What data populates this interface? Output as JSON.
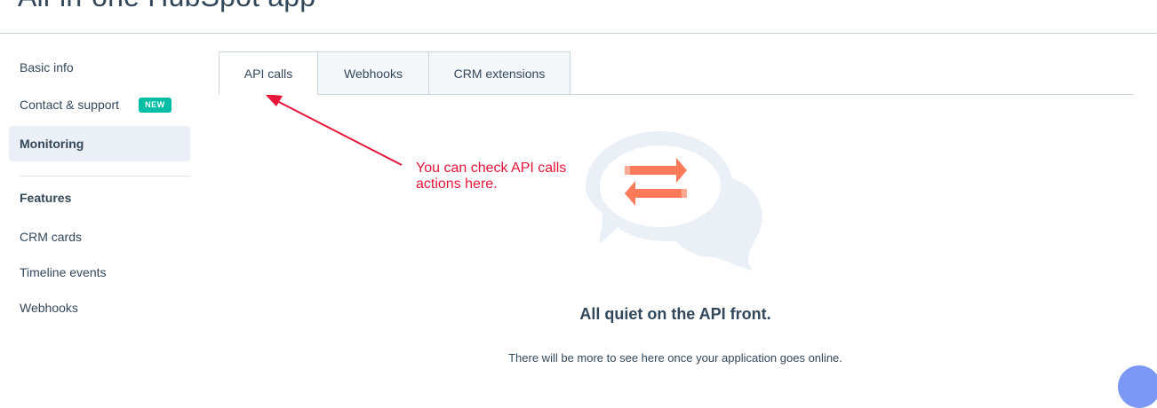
{
  "header": {
    "title": "All-in-one HubSpot app"
  },
  "sidebar": {
    "items": [
      {
        "label": "Basic info"
      },
      {
        "label": "Contact & support",
        "badge": "NEW"
      },
      {
        "label": "Monitoring",
        "active": true
      }
    ],
    "features_heading": "Features",
    "feature_items": [
      {
        "label": "CRM cards"
      },
      {
        "label": "Timeline events"
      },
      {
        "label": "Webhooks"
      }
    ]
  },
  "tabs": [
    {
      "label": "API calls",
      "active": true
    },
    {
      "label": "Webhooks"
    },
    {
      "label": "CRM extensions"
    }
  ],
  "empty_state": {
    "title": "All quiet on the API front.",
    "description": "There will be more to see here once your application goes online.",
    "icon": "chat-bubbles-arrows-icon"
  },
  "annotation": {
    "text": "You can check API calls actions here."
  },
  "colors": {
    "accent_orange": "#ff7a59",
    "badge_teal": "#00bda5",
    "annotation_red": "#e8153a",
    "text": "#33475b"
  }
}
